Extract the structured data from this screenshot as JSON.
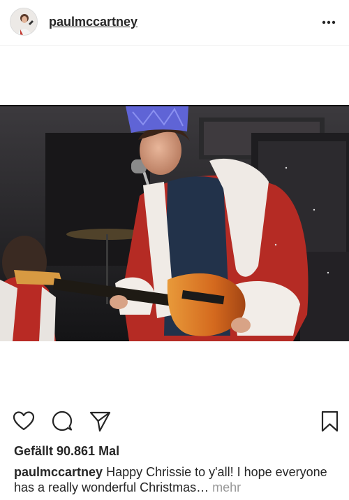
{
  "post": {
    "username": "paulmccartney",
    "likes_text": "Gefällt 90.861 Mal",
    "caption_user": "paulmccartney",
    "caption_text": " Happy Chrissie to y'all! I hope everyone has a really wonderful Christmas…",
    "more_label": " mehr"
  },
  "icons": {
    "more": "more-options-icon",
    "like": "heart-icon",
    "comment": "comment-icon",
    "share": "send-icon",
    "save": "bookmark-icon"
  }
}
